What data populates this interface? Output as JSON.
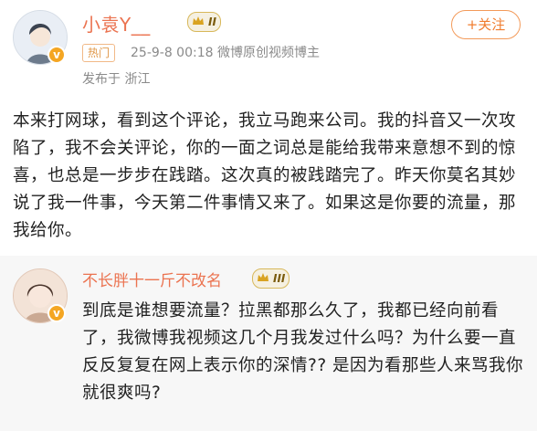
{
  "post": {
    "username": "小袁Y__",
    "level": "II",
    "tag": "热门",
    "timestamp": "25-9-8 00:18",
    "source": "微博原创视频博主",
    "location": "发布于 浙江",
    "follow_label": "+关注",
    "body": "本来打网球，看到这个评论，我立马跑来公司。我的抖音又一次攻陷了，我不会关评论，你的一面之词总是能给我带来意想不到的惊喜，也总是一步步在践踏。这次真的被践踏完了。昨天你莫名其妙说了我一件事，今天第二件事情又来了。如果这是你要的流量，那我给你。"
  },
  "comment": {
    "username": "不长胖十一斤不改名",
    "level": "III",
    "text": "到底是谁想要流量？拉黑都那么久了，我都已经向前看了，我微博我视频这几个月我发过什么吗？为什么要一直反反复复在网上表示你的深情?? 是因为看那些人来骂我你就很爽吗?"
  },
  "colors": {
    "username": "#eb7350",
    "follow": "#f07c2e",
    "meta": "#8a8a8a",
    "verified": "#f4a623"
  },
  "icons": [
    "avatar",
    "verified-icon",
    "crown-icon"
  ]
}
